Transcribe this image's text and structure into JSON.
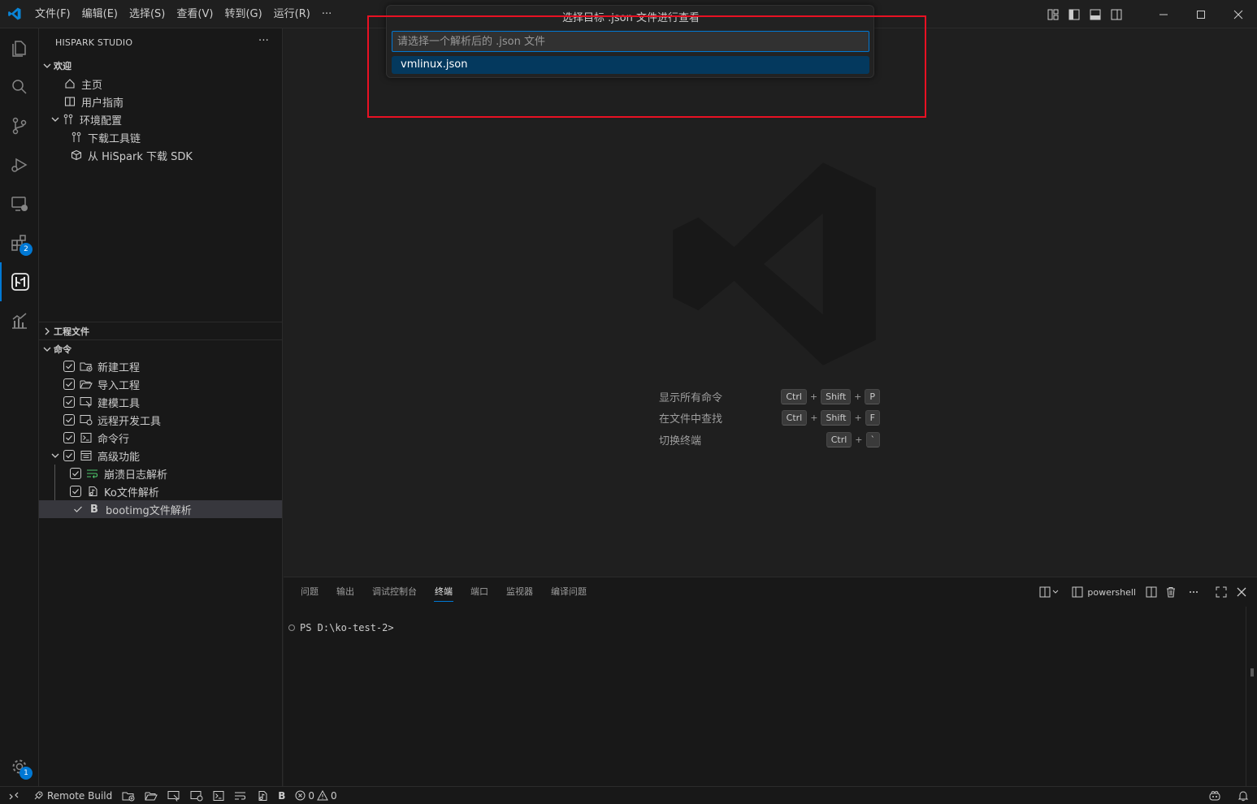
{
  "colors": {
    "accent": "#0078d4",
    "highlight": "#e81123",
    "selected_item": "#04395e"
  },
  "menu": [
    "文件(F)",
    "编辑(E)",
    "选择(S)",
    "查看(V)",
    "转到(G)",
    "运行(R)",
    "···"
  ],
  "activity_badges": {
    "extensions": "2",
    "settings": "1"
  },
  "sidebar": {
    "title": "HISPARK STUDIO",
    "more": "···",
    "welcome": {
      "header": "欢迎",
      "items": [
        "主页",
        "用户指南",
        "环境配置",
        "下载工具链",
        "从 HiSpark 下载 SDK"
      ]
    },
    "project": {
      "header": "工程文件"
    },
    "commands": {
      "header": "命令",
      "items": [
        "新建工程",
        "导入工程",
        "建模工具",
        "远程开发工具",
        "命令行",
        "高级功能",
        "崩溃日志解析",
        "Ko文件解析",
        "bootimg文件解析"
      ]
    }
  },
  "quickpick": {
    "title": "选择目标 .json 文件进行查看",
    "placeholder": "请选择一个解析后的 .json 文件",
    "items": [
      "vmlinux.json"
    ]
  },
  "shortcuts": [
    {
      "label": "显示所有命令",
      "keys": [
        "Ctrl",
        "Shift",
        "P"
      ]
    },
    {
      "label": "在文件中查找",
      "keys": [
        "Ctrl",
        "Shift",
        "F"
      ]
    },
    {
      "label": "切换终端",
      "keys": [
        "Ctrl",
        "`"
      ]
    }
  ],
  "panel": {
    "tabs": [
      "问题",
      "输出",
      "调试控制台",
      "终端",
      "端口",
      "监视器",
      "编译问题"
    ],
    "active_tab": "终端",
    "shell": "powershell",
    "terminal_line": "PS D:\\ko-test-2>"
  },
  "statusbar": {
    "remote_build": "Remote Build",
    "b_label": "B",
    "errors": "0",
    "warnings": "0"
  }
}
